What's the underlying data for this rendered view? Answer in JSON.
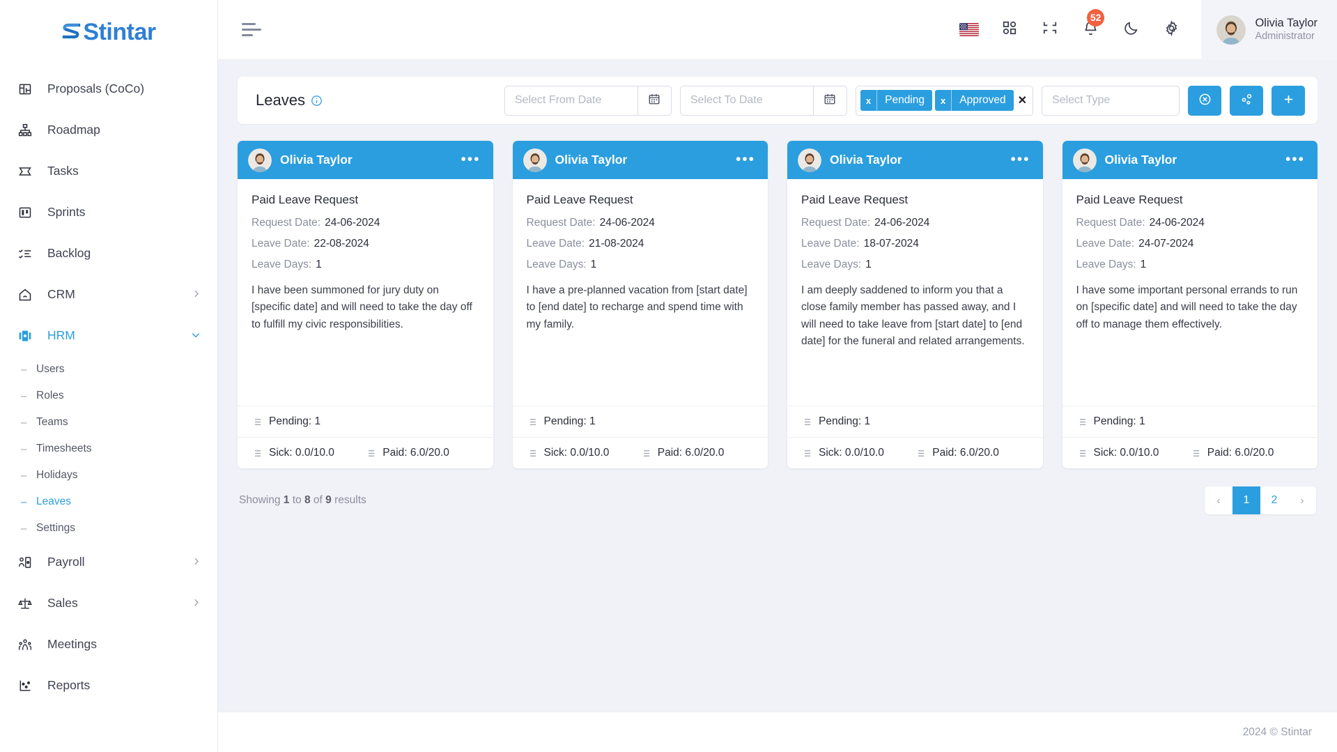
{
  "brand": {
    "name": "Stintar"
  },
  "sidebar": {
    "items": [
      {
        "label": "Proposals (CoCo)",
        "icon": "proposals-icon",
        "has_chevron": false
      },
      {
        "label": "Roadmap",
        "icon": "roadmap-icon",
        "has_chevron": false
      },
      {
        "label": "Tasks",
        "icon": "tasks-icon",
        "has_chevron": false
      },
      {
        "label": "Sprints",
        "icon": "sprints-icon",
        "has_chevron": false
      },
      {
        "label": "Backlog",
        "icon": "backlog-icon",
        "has_chevron": false
      },
      {
        "label": "CRM",
        "icon": "crm-icon",
        "has_chevron": true
      },
      {
        "label": "HRM",
        "icon": "hrm-icon",
        "has_chevron": true,
        "active": true
      }
    ],
    "hrm_children": [
      {
        "label": "Users"
      },
      {
        "label": "Roles"
      },
      {
        "label": "Teams"
      },
      {
        "label": "Timesheets"
      },
      {
        "label": "Holidays"
      },
      {
        "label": "Leaves",
        "active": true
      },
      {
        "label": "Settings"
      }
    ],
    "items_after": [
      {
        "label": "Payroll",
        "icon": "payroll-icon",
        "has_chevron": true
      },
      {
        "label": "Sales",
        "icon": "sales-icon",
        "has_chevron": true
      },
      {
        "label": "Meetings",
        "icon": "meetings-icon",
        "has_chevron": false
      },
      {
        "label": "Reports",
        "icon": "reports-icon",
        "has_chevron": false
      }
    ]
  },
  "topbar": {
    "menu_icon": "hamburger-menu-icon",
    "language_icon": "us-flag-icon",
    "apps_icon": "apps-grid-icon",
    "fullscreen_icon": "collapse-screen-icon",
    "notifications_icon": "bell-icon",
    "notifications_count": "52",
    "theme_icon": "moon-icon",
    "settings_icon": "gear-icon",
    "user": {
      "name": "Olivia Taylor",
      "role": "Administrator"
    }
  },
  "filters": {
    "title": "Leaves",
    "info_icon": "info-circle-icon",
    "from_date": {
      "placeholder": "Select From Date",
      "value": "",
      "icon": "calendar-icon"
    },
    "to_date": {
      "placeholder": "Select To Date",
      "value": "",
      "icon": "calendar-icon"
    },
    "status_chips": [
      {
        "label": "Pending",
        "remove_icon": "x"
      },
      {
        "label": "Approved",
        "remove_icon": "x"
      }
    ],
    "clear_all": "✕",
    "type_select": {
      "placeholder": "Select Type",
      "value": ""
    },
    "buttons": [
      {
        "name": "reset-filter-button",
        "icon": "cancel-circle-icon",
        "glyph": "⊗",
        "color": "#2b9ee0"
      },
      {
        "name": "group-filter-button",
        "icon": "share-nodes-icon",
        "glyph": "",
        "color": "#2b9ee0"
      },
      {
        "name": "add-leave-button",
        "icon": "plus-icon",
        "glyph": "+",
        "color": "#2b9ee0"
      }
    ]
  },
  "cards": [
    {
      "user": "Olivia Taylor",
      "menu_icon": "ellipsis-icon",
      "title": "Paid Leave Request",
      "request_date_label": "Request Date:",
      "request_date": "24-06-2024",
      "leave_date_label": "Leave Date:",
      "leave_date": "22-08-2024",
      "leave_days_label": "Leave Days:",
      "leave_days": "1",
      "description": "I have been summoned for jury duty on [specific date] and will need to take the day off to fulfill my civic responsibilities.",
      "pending": "Pending: 1",
      "sick": "Sick: 0.0/10.0",
      "paid": "Paid: 6.0/20.0"
    },
    {
      "user": "Olivia Taylor",
      "menu_icon": "ellipsis-icon",
      "title": "Paid Leave Request",
      "request_date_label": "Request Date:",
      "request_date": "24-06-2024",
      "leave_date_label": "Leave Date:",
      "leave_date": "21-08-2024",
      "leave_days_label": "Leave Days:",
      "leave_days": "1",
      "description": "I have a pre-planned vacation from [start date] to [end date] to recharge and spend time with my family.",
      "pending": "Pending: 1",
      "sick": "Sick: 0.0/10.0",
      "paid": "Paid: 6.0/20.0"
    },
    {
      "user": "Olivia Taylor",
      "menu_icon": "ellipsis-icon",
      "title": "Paid Leave Request",
      "request_date_label": "Request Date:",
      "request_date": "24-06-2024",
      "leave_date_label": "Leave Date:",
      "leave_date": "18-07-2024",
      "leave_days_label": "Leave Days:",
      "leave_days": "1",
      "description": "I am deeply saddened to inform you that a close family member has passed away, and I will need to take leave from [start date] to [end date] for the funeral and related arrangements.",
      "pending": "Pending: 1",
      "sick": "Sick: 0.0/10.0",
      "paid": "Paid: 6.0/20.0"
    },
    {
      "user": "Olivia Taylor",
      "menu_icon": "ellipsis-icon",
      "title": "Paid Leave Request",
      "request_date_label": "Request Date:",
      "request_date": "24-06-2024",
      "leave_date_label": "Leave Date:",
      "leave_date": "24-07-2024",
      "leave_days_label": "Leave Days:",
      "leave_days": "1",
      "description": "I have some important personal errands to run on [specific date] and will need to take the day off to manage them effectively.",
      "pending": "Pending: 1",
      "sick": "Sick: 0.0/10.0",
      "paid": "Paid: 6.0/20.0"
    }
  ],
  "pagination": {
    "showing_prefix": "Showing",
    "from": "1",
    "to_word": "to",
    "to": "8",
    "of_word": "of",
    "total": "9",
    "results_word": "results",
    "prev": "‹",
    "pages": [
      "1",
      "2"
    ],
    "next": "›",
    "active_page": "1"
  },
  "footer": {
    "copyright": "2024 © Stintar"
  },
  "colors": {
    "accent": "#2b9ee0",
    "badge": "#f2613f",
    "page_bg": "#f1f2f7"
  }
}
